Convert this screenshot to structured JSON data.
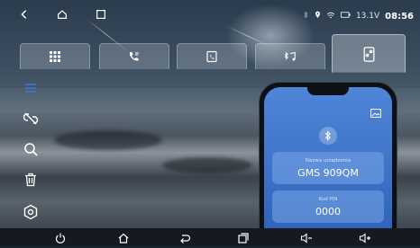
{
  "status_bar": {
    "voltage": "13.1V",
    "time": "08:56",
    "icons": [
      "bluetooth-icon",
      "location-icon",
      "wifi-icon",
      "battery-icon"
    ]
  },
  "system_buttons": [
    "back-icon",
    "home-icon",
    "recents-icon"
  ],
  "tabs": [
    {
      "name": "tab-apps",
      "icon": "grid-icon",
      "active": false
    },
    {
      "name": "tab-call",
      "icon": "phone-call-icon",
      "active": false
    },
    {
      "name": "tab-contacts",
      "icon": "phonebook-icon",
      "active": false
    },
    {
      "name": "tab-music",
      "icon": "bluetooth-music-icon",
      "active": false
    },
    {
      "name": "tab-settings",
      "icon": "phone-link-icon",
      "active": true
    }
  ],
  "sidebar": [
    "menu-icon",
    "unlink-icon",
    "search-icon",
    "trash-icon",
    "settings-icon"
  ],
  "phone_card": {
    "device_name_label": "Nazwa urządzenia",
    "device_name_value": "GMS 909QM",
    "pin_label": "Kod PIN",
    "pin_value": "0000"
  },
  "nav_bar": [
    "power-icon",
    "home-icon",
    "back-icon",
    "recents-icon",
    "volume-down-icon",
    "volume-up-icon"
  ],
  "colors": {
    "accent": "#3e73c8",
    "field": "#78a5e6",
    "navbar": "#151a20"
  }
}
